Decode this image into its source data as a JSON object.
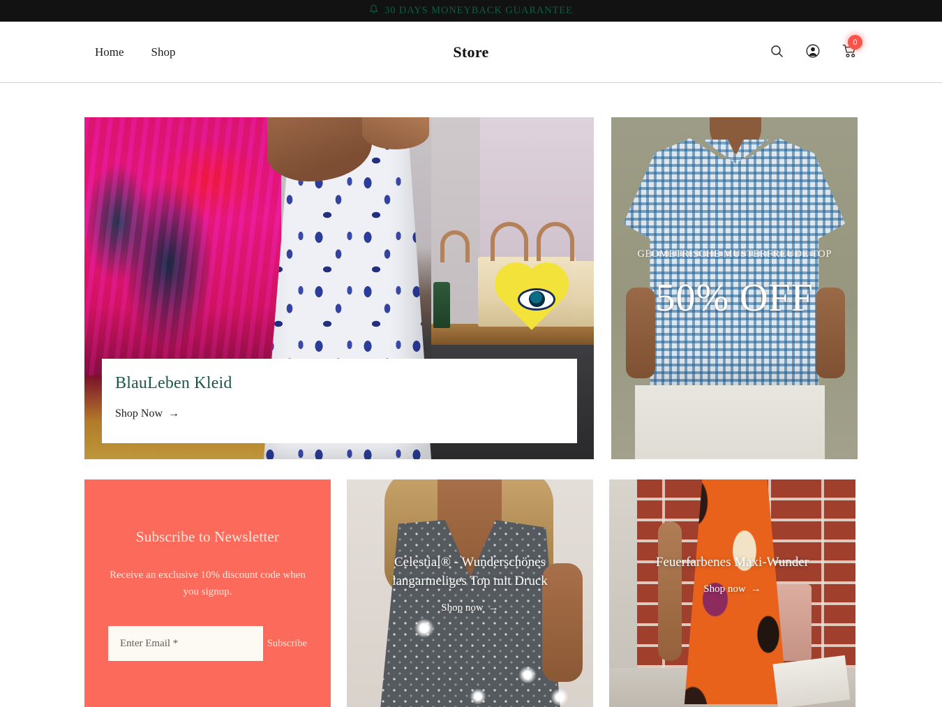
{
  "announcement": {
    "icon": "bell-icon",
    "text": "30 DAYS MONEYBACK GUARANTEE",
    "color": "#0f5c45",
    "background": "#121212"
  },
  "header": {
    "brand": "Store",
    "nav": [
      {
        "label": "Home"
      },
      {
        "label": "Shop"
      }
    ],
    "actions": {
      "search_icon": "search-icon",
      "account_icon": "account-icon",
      "cart_icon": "cart-icon",
      "cart_count": "0",
      "cart_badge_color": "#f8544a"
    }
  },
  "hero": {
    "title": "BlauLeben Kleid",
    "title_color": "#17584a",
    "cta": "Shop Now",
    "cta_arrow": "→"
  },
  "promo": {
    "subtitle": "GEOMETRISCHE MUSTERFREUDE TOP",
    "discount": "50% OFF"
  },
  "newsletter": {
    "title": "Subscribe to Newsletter",
    "subtitle": "Receive an exclusive 10% discount code when you signup.",
    "placeholder": "Enter Email *",
    "input_value": "",
    "submit_label": "Subscribe",
    "background": "#fb6a5b"
  },
  "products": [
    {
      "title": "Celestial® - Wunderschönes langarmeliges Top mit Druck",
      "cta": "Shop now",
      "cta_arrow": "→"
    },
    {
      "title": "Feuerfarbenes Maxi-Wunder",
      "cta": "Shop now",
      "cta_arrow": "→"
    }
  ]
}
